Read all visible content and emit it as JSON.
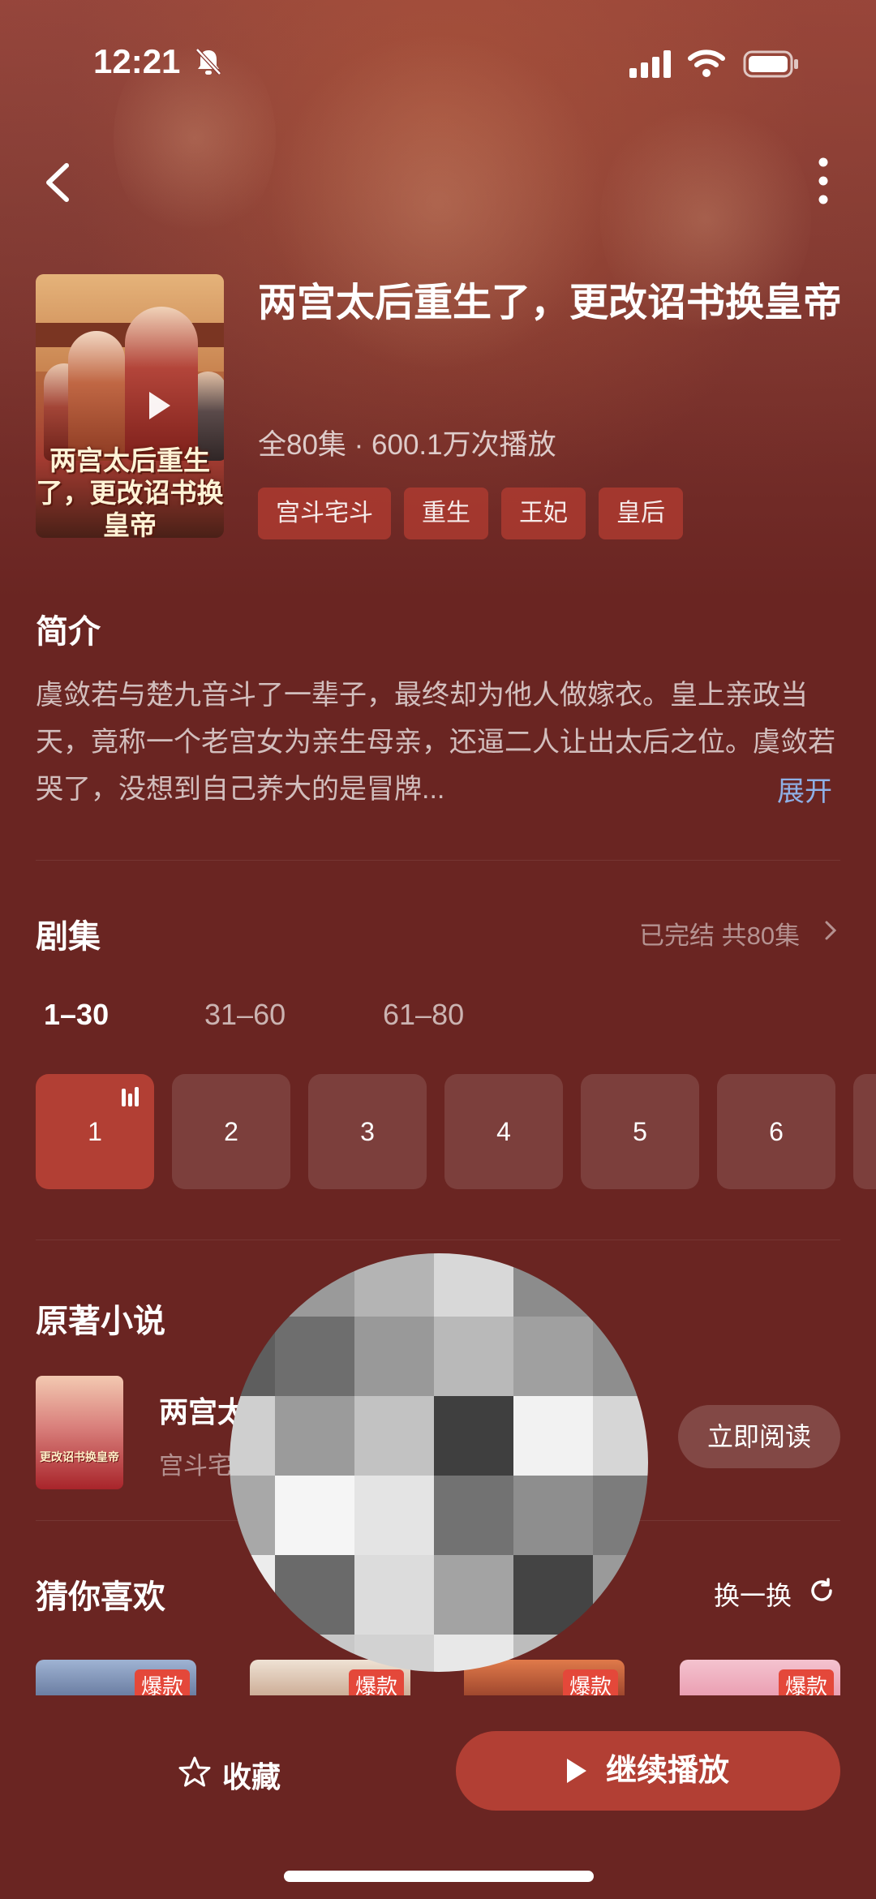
{
  "status_bar": {
    "time": "12:21"
  },
  "drama": {
    "title": "两宫太后重生了，更改诏书换皇帝",
    "meta": "全80集 · 600.1万次播放",
    "poster_text": "两宫太后重生了，更改诏书换皇帝",
    "tags": [
      "宫斗宅斗",
      "重生",
      "王妃",
      "皇后"
    ]
  },
  "synopsis": {
    "heading": "简介",
    "text": "虞敛若与楚九音斗了一辈子，最终却为他人做嫁衣。皇上亲政当天，竟称一个老宫女为亲生母亲，还逼二人让出太后之位。虞敛若哭了，没想到自己养大的是冒牌...",
    "expand_label": "展开"
  },
  "episodes": {
    "heading": "剧集",
    "status": "已完结 共80集",
    "ranges": [
      "1–30",
      "31–60",
      "61–80"
    ],
    "active_range": "1–30",
    "tiles": [
      "1",
      "2",
      "3",
      "4",
      "5",
      "6"
    ],
    "current_episode": "1"
  },
  "novel": {
    "heading": "原著小说",
    "title": "两宫太",
    "subtitle": "宫斗宅",
    "cover_text": "更改诏书换皇帝",
    "read_label": "立即阅读"
  },
  "recommend": {
    "heading": "猜你喜欢",
    "refresh_label": "换一换",
    "badges": [
      "爆款",
      "爆款",
      "爆款",
      "爆款"
    ]
  },
  "bottom_bar": {
    "favorite_label": "收藏",
    "continue_label": "继续播放"
  },
  "colors": {
    "background": "#6a2522",
    "accent": "#b23f34",
    "badge": "#e4483a",
    "link": "#8fb0e6"
  }
}
